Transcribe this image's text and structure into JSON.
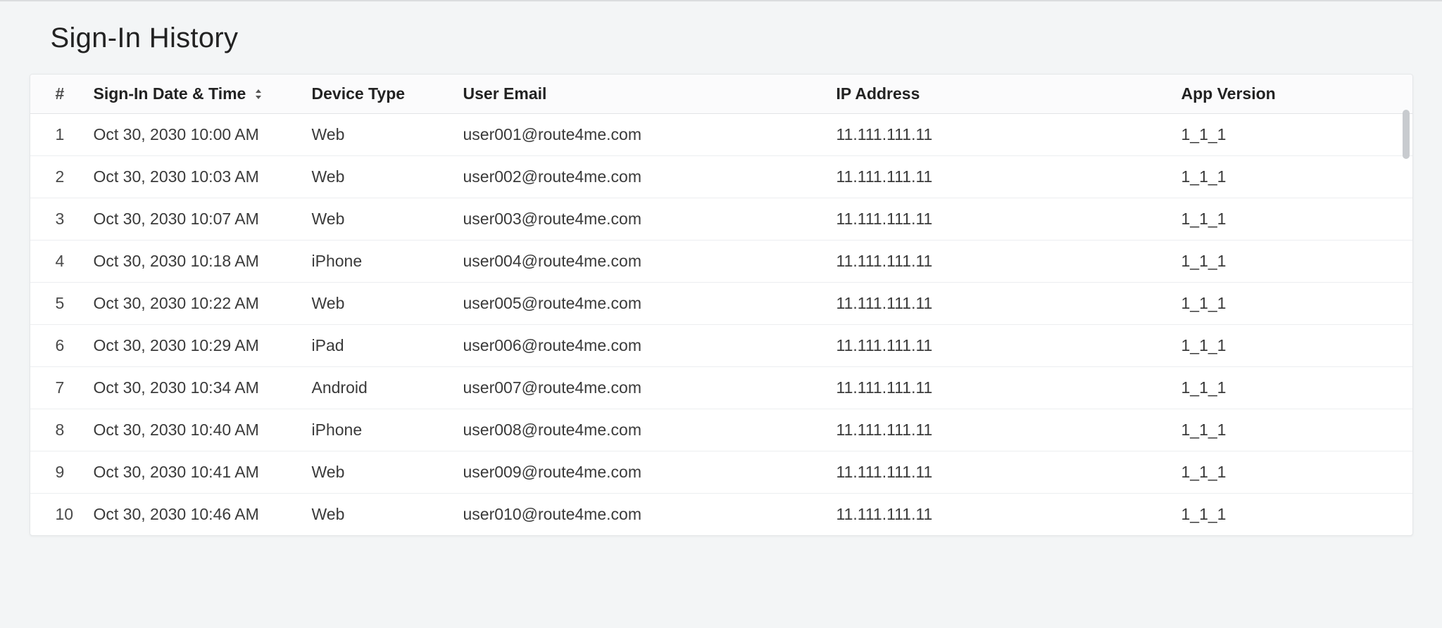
{
  "title": "Sign-In History",
  "columns": {
    "index": "#",
    "date": "Sign-In Date & Time",
    "device": "Device Type",
    "email": "User Email",
    "ip": "IP Address",
    "version": "App Version"
  },
  "rows": [
    {
      "n": "1",
      "date": "Oct 30, 2030 10:00 AM",
      "device": "Web",
      "email": "user001@route4me.com",
      "ip": "11.111.111.11",
      "version": "1_1_1"
    },
    {
      "n": "2",
      "date": "Oct 30, 2030 10:03 AM",
      "device": "Web",
      "email": "user002@route4me.com",
      "ip": "11.111.111.11",
      "version": "1_1_1"
    },
    {
      "n": "3",
      "date": "Oct 30, 2030 10:07 AM",
      "device": "Web",
      "email": "user003@route4me.com",
      "ip": "11.111.111.11",
      "version": "1_1_1"
    },
    {
      "n": "4",
      "date": "Oct 30, 2030 10:18 AM",
      "device": "iPhone",
      "email": "user004@route4me.com",
      "ip": "11.111.111.11",
      "version": "1_1_1"
    },
    {
      "n": "5",
      "date": "Oct 30, 2030 10:22 AM",
      "device": "Web",
      "email": "user005@route4me.com",
      "ip": "11.111.111.11",
      "version": "1_1_1"
    },
    {
      "n": "6",
      "date": "Oct 30, 2030 10:29 AM",
      "device": "iPad",
      "email": "user006@route4me.com",
      "ip": "11.111.111.11",
      "version": "1_1_1"
    },
    {
      "n": "7",
      "date": "Oct 30, 2030 10:34 AM",
      "device": "Android",
      "email": "user007@route4me.com",
      "ip": "11.111.111.11",
      "version": "1_1_1"
    },
    {
      "n": "8",
      "date": "Oct 30, 2030 10:40 AM",
      "device": "iPhone",
      "email": "user008@route4me.com",
      "ip": "11.111.111.11",
      "version": "1_1_1"
    },
    {
      "n": "9",
      "date": "Oct 30, 2030 10:41 AM",
      "device": "Web",
      "email": "user009@route4me.com",
      "ip": "11.111.111.11",
      "version": "1_1_1"
    },
    {
      "n": "10",
      "date": "Oct 30, 2030 10:46 AM",
      "device": "Web",
      "email": "user010@route4me.com",
      "ip": "11.111.111.11",
      "version": "1_1_1"
    }
  ]
}
